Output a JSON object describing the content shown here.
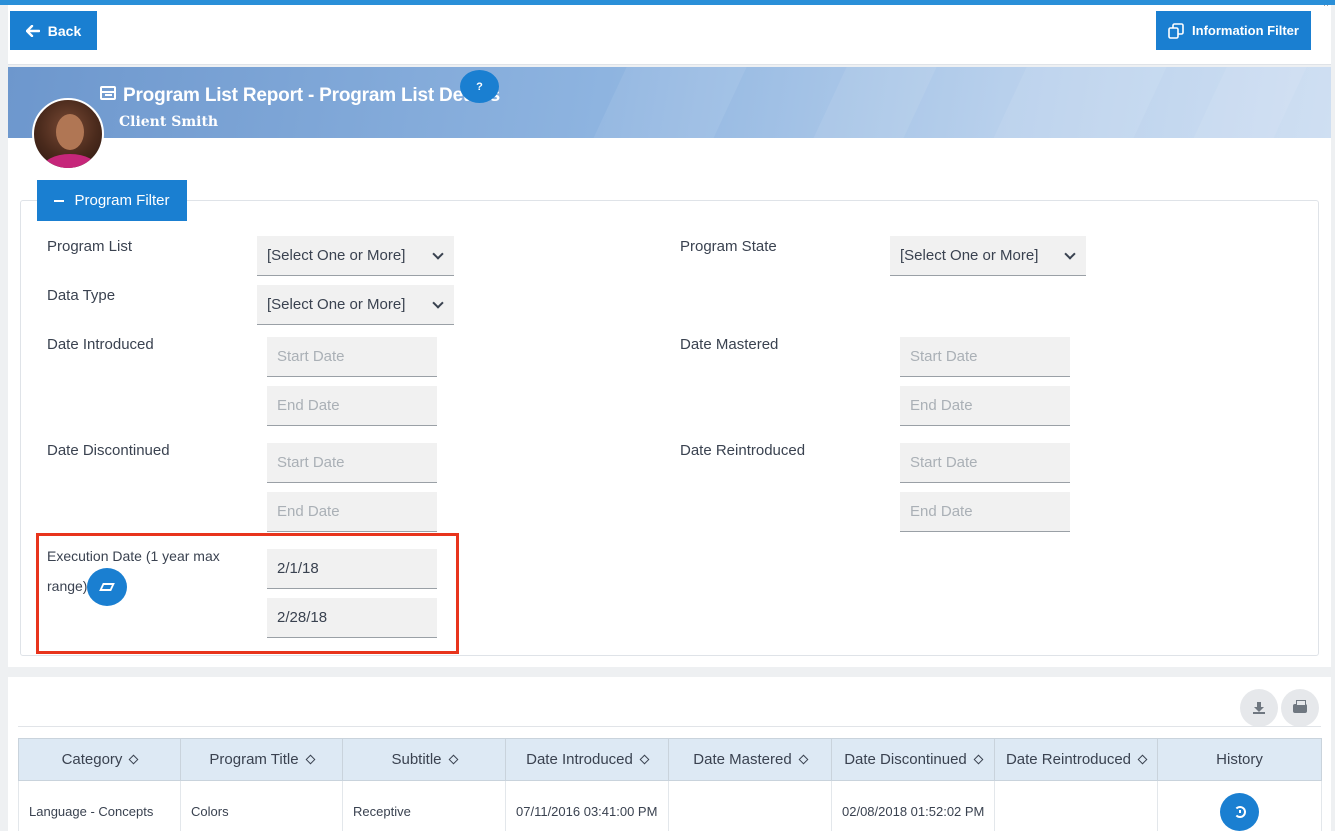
{
  "toolbar": {
    "back_label": "Back",
    "info_filter_label": "Information Filter"
  },
  "header": {
    "title": "Program List Report - Program List Details",
    "client_name": "Client Smith",
    "help_label": "?"
  },
  "filter": {
    "toggle_label": "Program Filter",
    "program_list": {
      "label": "Program List",
      "value": "[Select One or More]"
    },
    "program_state": {
      "label": "Program State",
      "value": "[Select One or More]"
    },
    "data_type": {
      "label": "Data Type",
      "value": "[Select One or More]"
    },
    "date_introduced": {
      "label": "Date Introduced",
      "start_placeholder": "Start Date",
      "end_placeholder": "End Date"
    },
    "date_mastered": {
      "label": "Date Mastered",
      "start_placeholder": "Start Date",
      "end_placeholder": "End Date"
    },
    "date_discontinued": {
      "label": "Date Discontinued",
      "start_placeholder": "Start Date",
      "end_placeholder": "End Date"
    },
    "date_reintroduced": {
      "label": "Date Reintroduced",
      "start_placeholder": "Start Date",
      "end_placeholder": "End Date"
    },
    "execution_date": {
      "label_line1": "Execution Date (1 year max",
      "label_line2": "range)",
      "start_value": "2/1/18",
      "end_value": "2/28/18"
    }
  },
  "table": {
    "columns": [
      "Category",
      "Program Title",
      "Subtitle",
      "Date Introduced",
      "Date Mastered",
      "Date Discontinued",
      "Date Reintroduced",
      "History"
    ],
    "rows": [
      [
        "Language - Concepts",
        "Colors",
        "Receptive",
        "07/11/2016 03:41:00 PM",
        "",
        "02/08/2018 01:52:02 PM",
        "",
        ""
      ]
    ]
  },
  "colors": {
    "accent": "#1a7fd1",
    "highlight": "#e8341c",
    "header_row": "#dde9f4"
  }
}
